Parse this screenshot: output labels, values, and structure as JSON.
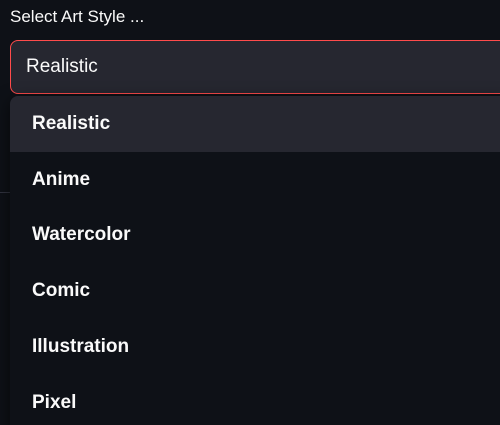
{
  "label": "Select Art Style ...",
  "select": {
    "value": "Realistic"
  },
  "options": [
    {
      "label": "Realistic"
    },
    {
      "label": "Anime"
    },
    {
      "label": "Watercolor"
    },
    {
      "label": "Comic"
    },
    {
      "label": "Illustration"
    },
    {
      "label": "Pixel"
    }
  ],
  "colors": {
    "background": "#0e1117",
    "field_bg": "#262730",
    "focus_border": "#ff4b4b",
    "text": "#fafafa"
  }
}
